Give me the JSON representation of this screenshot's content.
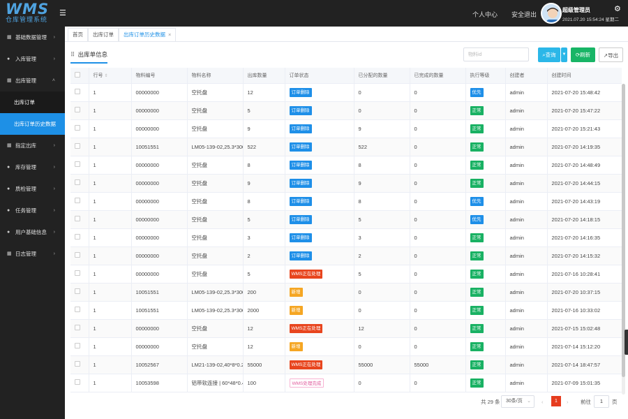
{
  "header": {
    "logo_text": "WMS",
    "logo_subtitle": "仓库管理系统",
    "links": {
      "profile": "个人中心",
      "logout": "安全退出"
    },
    "user_name": "超级管理员",
    "user_time": "2021.07.20 15:54:24 星期二"
  },
  "sidebar": {
    "items": [
      {
        "label": "基础数据管理",
        "icon": "grid-icon"
      },
      {
        "label": "入库管理",
        "icon": "circle-icon"
      },
      {
        "label": "出库管理",
        "icon": "grid-icon",
        "expanded": true
      },
      {
        "label": "指定出库",
        "icon": "grid-icon"
      },
      {
        "label": "库存管理",
        "icon": "circle-icon"
      },
      {
        "label": "质检管理",
        "icon": "circle-icon"
      },
      {
        "label": "任务管理",
        "icon": "circle-icon"
      },
      {
        "label": "用户基础信息",
        "icon": "circle-icon"
      },
      {
        "label": "日志管理",
        "icon": "grid-icon"
      }
    ],
    "subitems": [
      {
        "label": "出库订单",
        "active": false
      },
      {
        "label": "出库订单历史数据",
        "active": true
      }
    ]
  },
  "tabs": [
    {
      "label": "首页"
    },
    {
      "label": "出库订单"
    },
    {
      "label": "出库订单历史数据",
      "active": true,
      "closable": "×"
    }
  ],
  "panel": {
    "title": "出库单信息",
    "search_placeholder": "物料id",
    "buttons": {
      "query": "查询",
      "refresh": "刷新",
      "export": "导出"
    }
  },
  "table": {
    "columns": [
      "行号",
      "物料编号",
      "物料名称",
      "出库数量",
      "订单状态",
      "已分配的数量",
      "已完成的数量",
      "执行等级",
      "创建者",
      "创建时间"
    ],
    "rows": [
      [
        "1",
        "00000000",
        "空托盘",
        "12",
        "订单删除",
        "0",
        "0",
        "优先",
        "admin",
        "2021-07-20 15:48:42"
      ],
      [
        "1",
        "00000000",
        "空托盘",
        "5",
        "订单删除",
        "0",
        "0",
        "正常",
        "admin",
        "2021-07-20 15:47:22"
      ],
      [
        "1",
        "00000000",
        "空托盘",
        "9",
        "订单删除",
        "9",
        "0",
        "正常",
        "admin",
        "2021-07-20 15:21:43"
      ],
      [
        "1",
        "10051551",
        "LM05-139-02,25.3*300.4*",
        "522",
        "订单删除",
        "522",
        "0",
        "正常",
        "admin",
        "2021-07-20 14:19:35"
      ],
      [
        "1",
        "00000000",
        "空托盘",
        "8",
        "订单删除",
        "8",
        "0",
        "正常",
        "admin",
        "2021-07-20 14:48:49"
      ],
      [
        "1",
        "00000000",
        "空托盘",
        "9",
        "订单删除",
        "9",
        "0",
        "正常",
        "admin",
        "2021-07-20 14:44:15"
      ],
      [
        "1",
        "00000000",
        "空托盘",
        "8",
        "订单删除",
        "8",
        "0",
        "优先",
        "admin",
        "2021-07-20 14:43:19"
      ],
      [
        "1",
        "00000000",
        "空托盘",
        "5",
        "订单删除",
        "5",
        "0",
        "优先",
        "admin",
        "2021-07-20 14:18:15"
      ],
      [
        "1",
        "00000000",
        "空托盘",
        "3",
        "订单删除",
        "3",
        "0",
        "正常",
        "admin",
        "2021-07-20 14:16:35"
      ],
      [
        "1",
        "00000000",
        "空托盘",
        "2",
        "订单删除",
        "2",
        "0",
        "正常",
        "admin",
        "2021-07-20 14:15:32"
      ],
      [
        "1",
        "00000000",
        "空托盘",
        "5",
        "WMS正在处理",
        "5",
        "0",
        "正常",
        "admin",
        "2021-07-16 10:28:41"
      ],
      [
        "1",
        "10051551",
        "LM05-139-02,25.3*300.4*",
        "200",
        "新增",
        "0",
        "0",
        "正常",
        "admin",
        "2021-07-20 10:37:15"
      ],
      [
        "1",
        "10051551",
        "LM05-139-02,25.3*300.4*",
        "2000",
        "新增",
        "0",
        "0",
        "正常",
        "admin",
        "2021-07-16 10:33:02"
      ],
      [
        "1",
        "00000000",
        "空托盘",
        "12",
        "WMS正在处理",
        "12",
        "0",
        "正常",
        "admin",
        "2021-07-15 15:02:48"
      ],
      [
        "1",
        "00000000",
        "空托盘",
        "12",
        "新增",
        "0",
        "0",
        "正常",
        "admin",
        "2021-07-14 15:12:20"
      ],
      [
        "1",
        "10052567",
        "LM21-139-02,40*8*0.2",
        "55000",
        "WMS正在处理",
        "55000",
        "55000",
        "正常",
        "admin",
        "2021-07-14 18:47:57"
      ],
      [
        "1",
        "10053598",
        "铝带软连接 | 60*48*0.4mm",
        "100",
        "WMS处理完成",
        "0",
        "0",
        "正常",
        "admin",
        "2021-07-09 15:01:35"
      ]
    ]
  },
  "status_colors": {
    "订单删除": "#1e8fe8",
    "WMS正在处理": "#e8451e",
    "新增": "#f5a623",
    "WMS处理完成": "#f7b3d3",
    "优先": "#1e8fe8",
    "正常": "#19b163"
  },
  "pagination": {
    "total": "共 29 条",
    "page_size": "30条/页",
    "prev": "‹",
    "current": "1",
    "next": "›",
    "goto_label": "前往",
    "goto_value": "1",
    "page_suffix": "页"
  }
}
